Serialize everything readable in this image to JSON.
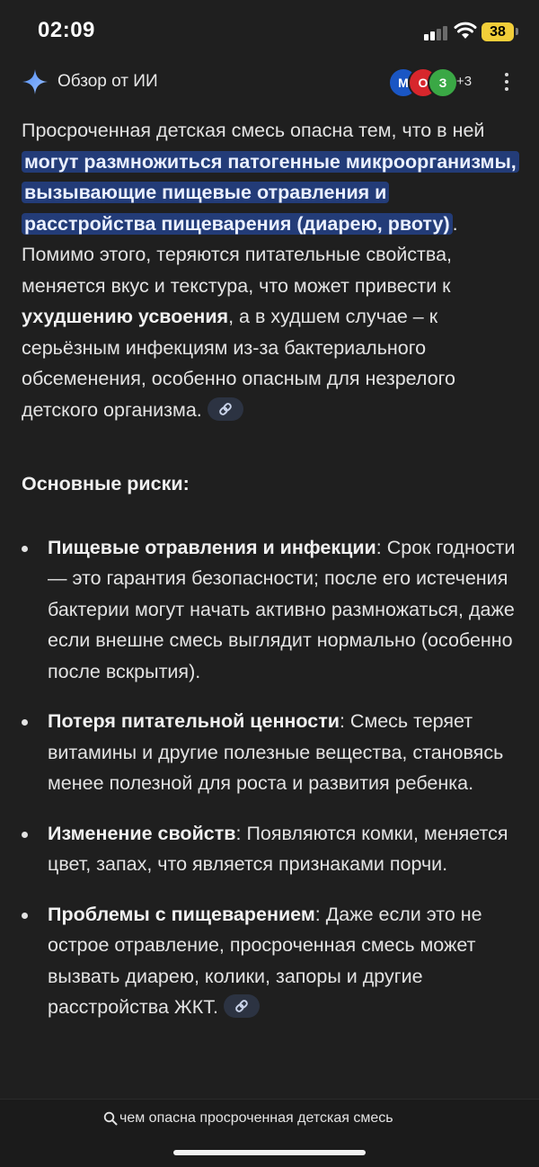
{
  "status_bar": {
    "time": "02:09",
    "battery": "38"
  },
  "header": {
    "title": "Обзор от ИИ",
    "sources": [
      {
        "name": "М",
        "color": "#1a56c4"
      },
      {
        "name": "О",
        "color": "#d7262c"
      },
      {
        "name": "З",
        "color": "#3aa845"
      }
    ],
    "more_sources": "+3"
  },
  "intro": {
    "part1": "Просроченная детская смесь опасна тем, что в ней ",
    "highlight": "могут размножиться патогенные микроорганизмы, вызывающие пищевые отравления и расстройства пищеварения (диарею, рвоту)",
    "part2": ". Помимо этого, теряются питательные свойства, меняется вкус и текстура, что может привести к ",
    "bold": "ухудшению усвоения",
    "part3": ", а в худшем случае – к серьёзным инфекциям из-за бактериального обсеменения, особенно опасным для незрелого детского организма."
  },
  "section_title": "Основные риски:",
  "risks": [
    {
      "title": "Пищевые отравления и инфекции",
      "text": ": Срок годности — это гарантия безопасности; после его истечения бактерии могут начать активно размножаться, даже если внешне смесь выглядит нормально (особенно после вскрытия)."
    },
    {
      "title": "Потеря питательной ценности",
      "text": ": Смесь теряет витамины и другие полезные вещества, становясь менее полезной для роста и развития ребенка."
    },
    {
      "title": "Изменение свойств",
      "text": ": Появляются комки, меняется цвет, запах, что является признаками порчи."
    },
    {
      "title": "Проблемы с пищеварением",
      "text": ": Даже если это не острое отравление, просроченная смесь может вызвать диарею, колики, запоры и другие расстройства ЖКТ."
    }
  ],
  "search": {
    "query": "чем опасна просроченная детская смесь"
  },
  "colors": {
    "background": "#1f1f1f",
    "highlight": "#233c78",
    "link_chip": "#2c3342",
    "battery": "#f2ce39"
  },
  "icons": [
    "signal-icon",
    "wifi-icon",
    "sparkle-icon",
    "more-vert-icon",
    "link-icon",
    "search-icon"
  ]
}
